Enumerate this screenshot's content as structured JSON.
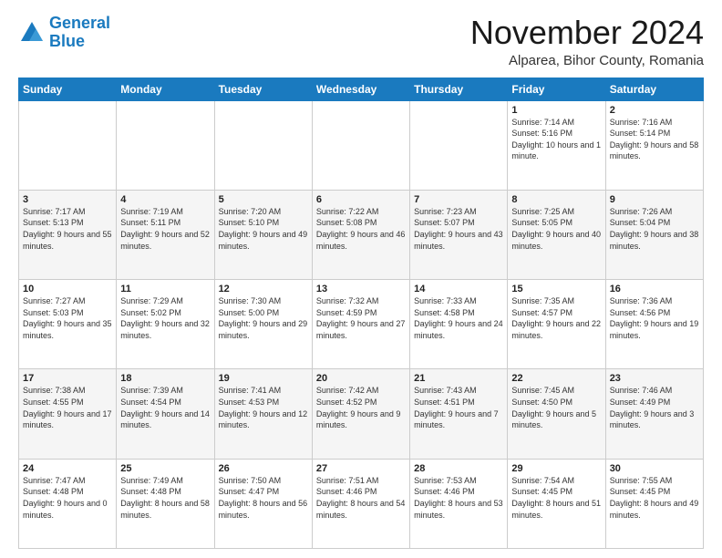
{
  "logo": {
    "line1": "General",
    "line2": "Blue"
  },
  "title": "November 2024",
  "subtitle": "Alparea, Bihor County, Romania",
  "headers": [
    "Sunday",
    "Monday",
    "Tuesday",
    "Wednesday",
    "Thursday",
    "Friday",
    "Saturday"
  ],
  "weeks": [
    [
      {
        "num": "",
        "info": ""
      },
      {
        "num": "",
        "info": ""
      },
      {
        "num": "",
        "info": ""
      },
      {
        "num": "",
        "info": ""
      },
      {
        "num": "",
        "info": ""
      },
      {
        "num": "1",
        "info": "Sunrise: 7:14 AM\nSunset: 5:16 PM\nDaylight: 10 hours and 1 minute."
      },
      {
        "num": "2",
        "info": "Sunrise: 7:16 AM\nSunset: 5:14 PM\nDaylight: 9 hours and 58 minutes."
      }
    ],
    [
      {
        "num": "3",
        "info": "Sunrise: 7:17 AM\nSunset: 5:13 PM\nDaylight: 9 hours and 55 minutes."
      },
      {
        "num": "4",
        "info": "Sunrise: 7:19 AM\nSunset: 5:11 PM\nDaylight: 9 hours and 52 minutes."
      },
      {
        "num": "5",
        "info": "Sunrise: 7:20 AM\nSunset: 5:10 PM\nDaylight: 9 hours and 49 minutes."
      },
      {
        "num": "6",
        "info": "Sunrise: 7:22 AM\nSunset: 5:08 PM\nDaylight: 9 hours and 46 minutes."
      },
      {
        "num": "7",
        "info": "Sunrise: 7:23 AM\nSunset: 5:07 PM\nDaylight: 9 hours and 43 minutes."
      },
      {
        "num": "8",
        "info": "Sunrise: 7:25 AM\nSunset: 5:05 PM\nDaylight: 9 hours and 40 minutes."
      },
      {
        "num": "9",
        "info": "Sunrise: 7:26 AM\nSunset: 5:04 PM\nDaylight: 9 hours and 38 minutes."
      }
    ],
    [
      {
        "num": "10",
        "info": "Sunrise: 7:27 AM\nSunset: 5:03 PM\nDaylight: 9 hours and 35 minutes."
      },
      {
        "num": "11",
        "info": "Sunrise: 7:29 AM\nSunset: 5:02 PM\nDaylight: 9 hours and 32 minutes."
      },
      {
        "num": "12",
        "info": "Sunrise: 7:30 AM\nSunset: 5:00 PM\nDaylight: 9 hours and 29 minutes."
      },
      {
        "num": "13",
        "info": "Sunrise: 7:32 AM\nSunset: 4:59 PM\nDaylight: 9 hours and 27 minutes."
      },
      {
        "num": "14",
        "info": "Sunrise: 7:33 AM\nSunset: 4:58 PM\nDaylight: 9 hours and 24 minutes."
      },
      {
        "num": "15",
        "info": "Sunrise: 7:35 AM\nSunset: 4:57 PM\nDaylight: 9 hours and 22 minutes."
      },
      {
        "num": "16",
        "info": "Sunrise: 7:36 AM\nSunset: 4:56 PM\nDaylight: 9 hours and 19 minutes."
      }
    ],
    [
      {
        "num": "17",
        "info": "Sunrise: 7:38 AM\nSunset: 4:55 PM\nDaylight: 9 hours and 17 minutes."
      },
      {
        "num": "18",
        "info": "Sunrise: 7:39 AM\nSunset: 4:54 PM\nDaylight: 9 hours and 14 minutes."
      },
      {
        "num": "19",
        "info": "Sunrise: 7:41 AM\nSunset: 4:53 PM\nDaylight: 9 hours and 12 minutes."
      },
      {
        "num": "20",
        "info": "Sunrise: 7:42 AM\nSunset: 4:52 PM\nDaylight: 9 hours and 9 minutes."
      },
      {
        "num": "21",
        "info": "Sunrise: 7:43 AM\nSunset: 4:51 PM\nDaylight: 9 hours and 7 minutes."
      },
      {
        "num": "22",
        "info": "Sunrise: 7:45 AM\nSunset: 4:50 PM\nDaylight: 9 hours and 5 minutes."
      },
      {
        "num": "23",
        "info": "Sunrise: 7:46 AM\nSunset: 4:49 PM\nDaylight: 9 hours and 3 minutes."
      }
    ],
    [
      {
        "num": "24",
        "info": "Sunrise: 7:47 AM\nSunset: 4:48 PM\nDaylight: 9 hours and 0 minutes."
      },
      {
        "num": "25",
        "info": "Sunrise: 7:49 AM\nSunset: 4:48 PM\nDaylight: 8 hours and 58 minutes."
      },
      {
        "num": "26",
        "info": "Sunrise: 7:50 AM\nSunset: 4:47 PM\nDaylight: 8 hours and 56 minutes."
      },
      {
        "num": "27",
        "info": "Sunrise: 7:51 AM\nSunset: 4:46 PM\nDaylight: 8 hours and 54 minutes."
      },
      {
        "num": "28",
        "info": "Sunrise: 7:53 AM\nSunset: 4:46 PM\nDaylight: 8 hours and 53 minutes."
      },
      {
        "num": "29",
        "info": "Sunrise: 7:54 AM\nSunset: 4:45 PM\nDaylight: 8 hours and 51 minutes."
      },
      {
        "num": "30",
        "info": "Sunrise: 7:55 AM\nSunset: 4:45 PM\nDaylight: 8 hours and 49 minutes."
      }
    ]
  ]
}
